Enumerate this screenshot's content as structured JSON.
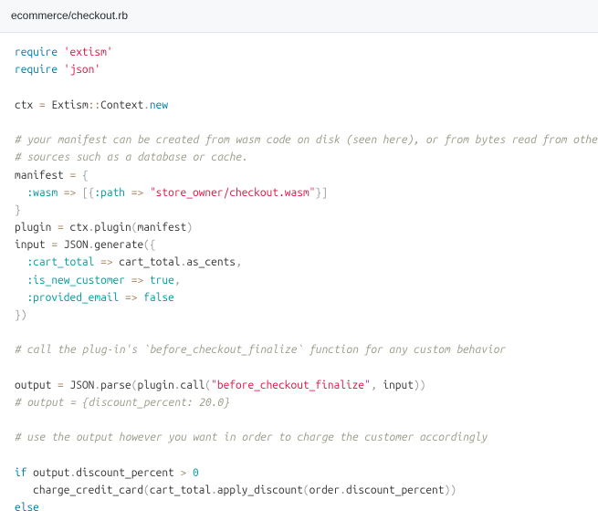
{
  "file_path": "ecommerce/checkout.rb",
  "code": {
    "lines": [
      [
        [
          "kw",
          "require"
        ],
        [
          "",
          ""
        ],
        [
          "str",
          "'extism'"
        ]
      ],
      [
        [
          "kw",
          "require"
        ],
        [
          "",
          ""
        ],
        [
          "str",
          "'json'"
        ]
      ],
      [],
      [
        [
          "id",
          "ctx "
        ],
        [
          "op",
          "="
        ],
        [
          "id",
          " Extism"
        ],
        [
          "op",
          "::"
        ],
        [
          "id",
          "Context"
        ],
        [
          "punc",
          "."
        ],
        [
          "kw",
          "new"
        ]
      ],
      [],
      [
        [
          "cmt",
          "# your manifest can be created from wasm code on disk (seen here), or from bytes read from other"
        ]
      ],
      [
        [
          "cmt",
          "# sources such as a database or cache."
        ]
      ],
      [
        [
          "id",
          "manifest "
        ],
        [
          "op",
          "="
        ],
        [
          "punc",
          " {"
        ]
      ],
      [
        [
          "id",
          "  "
        ],
        [
          "sym",
          ":wasm"
        ],
        [
          "id",
          " "
        ],
        [
          "op",
          "=>"
        ],
        [
          "punc",
          " [{"
        ],
        [
          "sym",
          ":path"
        ],
        [
          "id",
          " "
        ],
        [
          "op",
          "=>"
        ],
        [
          "id",
          " "
        ],
        [
          "str",
          "\"store_owner/checkout.wasm\""
        ],
        [
          "punc",
          "}]"
        ]
      ],
      [
        [
          "punc",
          "}"
        ]
      ],
      [
        [
          "id",
          "plugin "
        ],
        [
          "op",
          "="
        ],
        [
          "id",
          " ctx"
        ],
        [
          "punc",
          "."
        ],
        [
          "id",
          "plugin"
        ],
        [
          "punc",
          "("
        ],
        [
          "id",
          "manifest"
        ],
        [
          "punc",
          ")"
        ]
      ],
      [
        [
          "id",
          "input "
        ],
        [
          "op",
          "="
        ],
        [
          "id",
          " JSON"
        ],
        [
          "punc",
          "."
        ],
        [
          "id",
          "generate"
        ],
        [
          "punc",
          "({"
        ]
      ],
      [
        [
          "id",
          "  "
        ],
        [
          "sym",
          ":cart_total"
        ],
        [
          "id",
          " "
        ],
        [
          "op",
          "=>"
        ],
        [
          "id",
          " cart_total"
        ],
        [
          "punc",
          "."
        ],
        [
          "id",
          "as_cents"
        ],
        [
          "punc",
          ","
        ]
      ],
      [
        [
          "id",
          "  "
        ],
        [
          "sym",
          ":is_new_customer"
        ],
        [
          "id",
          " "
        ],
        [
          "op",
          "=>"
        ],
        [
          "id",
          " "
        ],
        [
          "bool",
          "true"
        ],
        [
          "punc",
          ","
        ]
      ],
      [
        [
          "id",
          "  "
        ],
        [
          "sym",
          ":provided_email"
        ],
        [
          "id",
          " "
        ],
        [
          "op",
          "=>"
        ],
        [
          "id",
          " "
        ],
        [
          "bool",
          "false"
        ]
      ],
      [
        [
          "punc",
          "})"
        ]
      ],
      [],
      [
        [
          "cmt",
          "# call the plug-in's `before_checkout_finalize` function for any custom behavior"
        ]
      ],
      [],
      [
        [
          "id",
          "output "
        ],
        [
          "op",
          "="
        ],
        [
          "id",
          " JSON"
        ],
        [
          "punc",
          "."
        ],
        [
          "id",
          "parse"
        ],
        [
          "punc",
          "("
        ],
        [
          "id",
          "plugin"
        ],
        [
          "punc",
          "."
        ],
        [
          "id",
          "call"
        ],
        [
          "punc",
          "("
        ],
        [
          "str",
          "\"before_checkout_finalize\""
        ],
        [
          "punc",
          ", "
        ],
        [
          "id",
          "input"
        ],
        [
          "punc",
          "))"
        ]
      ],
      [
        [
          "cmt",
          "# output = {discount_percent: 20.0}"
        ]
      ],
      [],
      [
        [
          "cmt",
          "# use the output however you want in order to charge the customer accordingly"
        ]
      ],
      [],
      [
        [
          "kw",
          "if"
        ],
        [
          "id",
          " output"
        ],
        [
          "punc",
          "."
        ],
        [
          "id",
          "discount_percent "
        ],
        [
          "op",
          ">"
        ],
        [
          "id",
          " "
        ],
        [
          "num",
          "0"
        ]
      ],
      [
        [
          "id",
          "   charge_credit_card"
        ],
        [
          "punc",
          "("
        ],
        [
          "id",
          "cart_total"
        ],
        [
          "punc",
          "."
        ],
        [
          "id",
          "apply_discount"
        ],
        [
          "punc",
          "("
        ],
        [
          "id",
          "order"
        ],
        [
          "punc",
          "."
        ],
        [
          "id",
          "discount_percent"
        ],
        [
          "punc",
          "))"
        ]
      ],
      [
        [
          "kw",
          "else"
        ]
      ]
    ]
  }
}
